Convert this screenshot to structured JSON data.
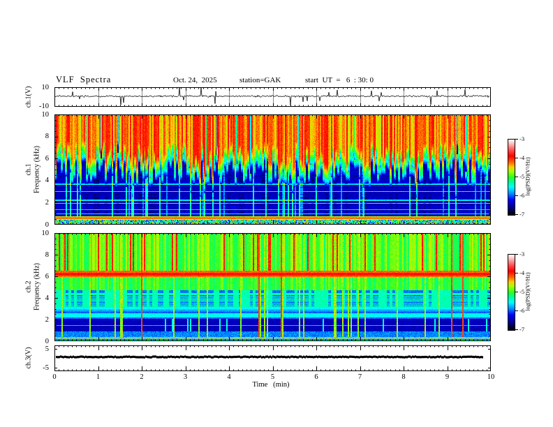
{
  "header": {
    "title": "VLF  Spectra",
    "date": "Oct. 24,  2025",
    "station": "station=GAK",
    "start_ut": "start  UT  =   6  : 30: 0"
  },
  "time_axis": {
    "label": "Time   (min)",
    "ticks": [
      0,
      1,
      2,
      3,
      4,
      5,
      6,
      7,
      8,
      9,
      10
    ],
    "range_min": [
      0,
      10
    ]
  },
  "colorbar": {
    "label": "log(PSD)(V²/Hz)",
    "ticks": [
      -3,
      -4,
      -5,
      -6,
      -7
    ],
    "gradient_stops": [
      {
        "pos": 0.0,
        "color": "#ffffff"
      },
      {
        "pos": 0.06,
        "color": "#ffb6b6"
      },
      {
        "pos": 0.14,
        "color": "#ff5050"
      },
      {
        "pos": 0.22,
        "color": "#ff0000"
      },
      {
        "pos": 0.3,
        "color": "#ff6400"
      },
      {
        "pos": 0.36,
        "color": "#ffc800"
      },
      {
        "pos": 0.42,
        "color": "#aaff00"
      },
      {
        "pos": 0.5,
        "color": "#28ff28"
      },
      {
        "pos": 0.56,
        "color": "#00ff96"
      },
      {
        "pos": 0.63,
        "color": "#00ffff"
      },
      {
        "pos": 0.71,
        "color": "#0096ff"
      },
      {
        "pos": 0.8,
        "color": "#0000ff"
      },
      {
        "pos": 0.91,
        "color": "#000082"
      },
      {
        "pos": 1.0,
        "color": "#000000"
      }
    ]
  },
  "panels": {
    "ch1_wave": {
      "ylabel": "ch.1(V)",
      "yticks": [
        10,
        -10
      ]
    },
    "ch1_spec": {
      "ylabel_line1": "ch.1",
      "ylabel_line2": "Frequency  (kHz)",
      "yticks": [
        10,
        8,
        6,
        4,
        2,
        0
      ]
    },
    "ch2_spec": {
      "ylabel_line1": "ch.2",
      "ylabel_line2": "Frequency  (kHz)",
      "yticks": [
        10,
        8,
        6,
        4,
        2,
        0
      ]
    },
    "ch3_wave": {
      "ylabel": "ch.3(V)",
      "yticks": [
        5,
        -5
      ]
    }
  },
  "chart_data": [
    {
      "type": "line",
      "panel": "ch1_waveform",
      "ylabel": "ch.1(V)",
      "ylim": [
        -10,
        10
      ],
      "x_minutes": [
        0,
        10
      ],
      "line_color": "#000000",
      "description": "continuous broadband noise trace near 0 V with frequent impulsive spikes up to about +8 V and down to about -10 V; vertical gridlines at every minute"
    },
    {
      "type": "heatmap",
      "panel": "ch1_spectrogram",
      "ylabel": "ch.1 Frequency (kHz)",
      "ylim_khz": [
        0,
        10
      ],
      "x_minutes": [
        0,
        10
      ],
      "value_scale": {
        "label": "log(PSD)(V²/Hz)",
        "range": [
          -7,
          -3
        ]
      },
      "bands": [
        {
          "freq_khz": [
            5.5,
            10.0
          ],
          "log_psd": -3.5,
          "appearance": "intense red/orange with yellow vertical striping and sparse dark columns"
        },
        {
          "freq_khz": [
            4.2,
            5.5
          ],
          "log_psd": -4.8,
          "appearance": "green/cyan transition, jagged column-to-column lower boundary (descending spikes)"
        },
        {
          "freq_khz": [
            0.75,
            4.2
          ],
          "log_psd": -6.4,
          "appearance": "dark blue background with bright cyan vertical impulse lines and thin horizontal cyan bands near 1.0, 1.4, 2.0, 2.3, 3.1, 3.7 kHz"
        },
        {
          "freq_khz": [
            0.45,
            0.75
          ],
          "log_psd": -4.3,
          "appearance": "strong yellow/orange horizontal band with thin red core near 0.6 kHz"
        },
        {
          "freq_khz": [
            0.0,
            0.45
          ],
          "log_psd": -5.2,
          "appearance": "multicolour speckle"
        }
      ]
    },
    {
      "type": "heatmap",
      "panel": "ch2_spectrogram",
      "ylabel": "ch.2 Frequency (kHz)",
      "ylim_khz": [
        0,
        10
      ],
      "x_minutes": [
        0,
        10
      ],
      "value_scale": {
        "label": "log(PSD)(V²/Hz)",
        "range": [
          -7,
          -3
        ]
      },
      "bands": [
        {
          "freq_khz": [
            6.55,
            10.0
          ],
          "log_psd": -4.9,
          "appearance": "green with yellow vertical striping and occasional red vertical lines"
        },
        {
          "freq_khz": [
            5.95,
            6.55
          ],
          "log_psd": -3.9,
          "appearance": "strong orange/red horizontal band near 6.2 kHz"
        },
        {
          "freq_khz": [
            4.75,
            5.95
          ],
          "log_psd": -5.0,
          "appearance": "green"
        },
        {
          "freq_khz": [
            3.1,
            4.75
          ],
          "log_psd": -5.4,
          "appearance": "cyan/green with blocky blue patches"
        },
        {
          "freq_khz": [
            2.1,
            3.1
          ],
          "log_psd": -5.6,
          "appearance": "cyan with blue horizontal rows"
        },
        {
          "freq_khz": [
            0.95,
            2.1
          ],
          "log_psd": -6.5,
          "appearance": "dark blue band with cyan vertical impulse lines"
        },
        {
          "freq_khz": [
            0.45,
            0.95
          ],
          "log_psd": -5.9,
          "appearance": "blue/cyan"
        },
        {
          "freq_khz": [
            0.0,
            0.45
          ],
          "log_psd": -4.0,
          "appearance": "mixed speckle with thin pink/red horizontal lines near 0.2-0.35 kHz and a dark row at the bottom"
        }
      ]
    },
    {
      "type": "line",
      "panel": "ch3_waveform",
      "ylabel": "ch.3(V)",
      "ylim": [
        -7,
        7
      ],
      "yticks": [
        5,
        -5
      ],
      "x_minutes": [
        0,
        9.85
      ],
      "value_v": 0,
      "line_color": "#000000",
      "description": "flat thick black trace at 0 V spanning almost the full record"
    }
  ]
}
